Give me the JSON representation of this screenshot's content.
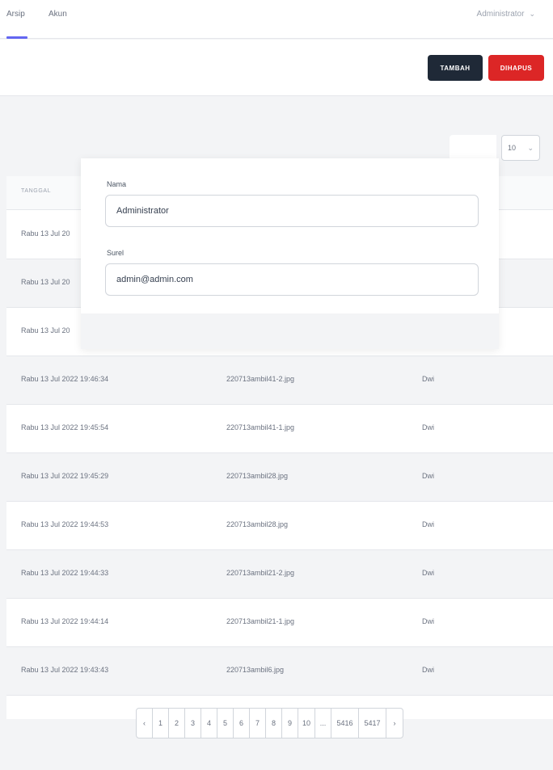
{
  "nav": {
    "links": [
      "Arsip",
      "Akun"
    ],
    "user_name": "Administrator",
    "user_chevron": "chevron-down-icon"
  },
  "actions": {
    "add_label": "TAMBAH",
    "delete_label": "DIHAPUS"
  },
  "table": {
    "per_page": "10",
    "header_date": "TANGGAL",
    "rows": [
      {
        "date": "Rabu 13 Jul 20",
        "file": "",
        "user": ""
      },
      {
        "date": "Rabu 13 Jul 20",
        "file": "",
        "user": ""
      },
      {
        "date": "Rabu 13 Jul 20",
        "file": "",
        "user": ""
      },
      {
        "date": "Rabu 13 Jul 2022 19:46:34",
        "file": "220713ambil41-2.jpg",
        "user": "Dwi"
      },
      {
        "date": "Rabu 13 Jul 2022 19:45:54",
        "file": "220713ambil41-1.jpg",
        "user": "Dwi"
      },
      {
        "date": "Rabu 13 Jul 2022 19:45:29",
        "file": "220713ambil28.jpg",
        "user": "Dwi"
      },
      {
        "date": "Rabu 13 Jul 2022 19:44:53",
        "file": "220713ambil28.jpg",
        "user": "Dwi"
      },
      {
        "date": "Rabu 13 Jul 2022 19:44:33",
        "file": "220713ambil21-2.jpg",
        "user": "Dwi"
      },
      {
        "date": "Rabu 13 Jul 2022 19:44:14",
        "file": "220713ambil21-1.jpg",
        "user": "Dwi"
      },
      {
        "date": "Rabu 13 Jul 2022 19:43:43",
        "file": "220713ambil6.jpg",
        "user": "Dwi"
      }
    ]
  },
  "pagination": {
    "prev": "‹",
    "pages": [
      "1",
      "2",
      "3",
      "4",
      "5",
      "6",
      "7",
      "8",
      "9",
      "10",
      "...",
      "5416",
      "5417"
    ],
    "next": "›"
  },
  "modal": {
    "name_label": "Nama",
    "name_value": "Administrator",
    "email_label": "Surel",
    "email_value": "admin@admin.com"
  }
}
